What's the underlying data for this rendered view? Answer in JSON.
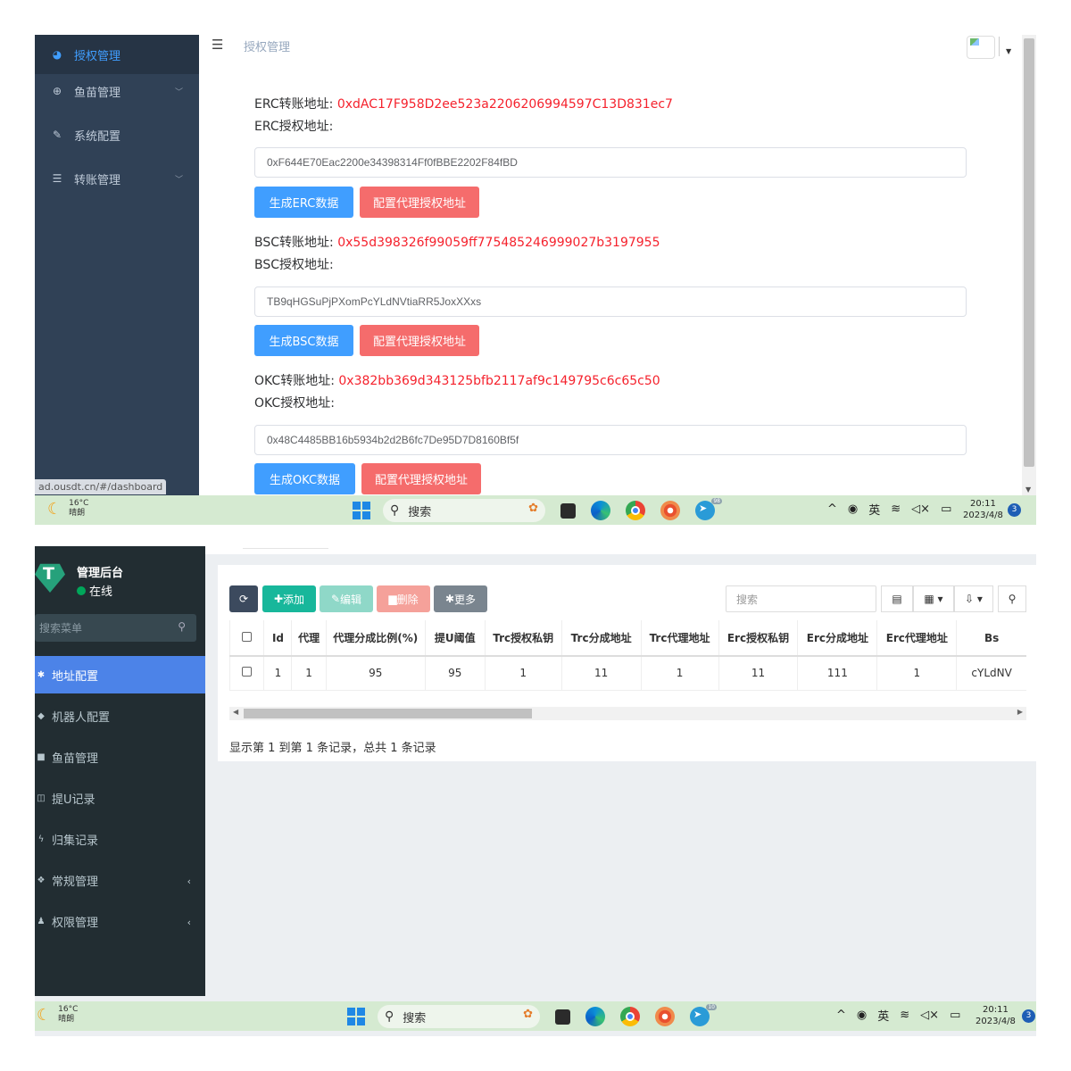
{
  "top": {
    "sidebar": {
      "items": [
        {
          "label": "授权管理",
          "icon": "dashboard-icon"
        },
        {
          "label": "鱼苗管理",
          "icon": "circle-plus-icon"
        },
        {
          "label": "系统配置",
          "icon": "document-edit-icon"
        },
        {
          "label": "转账管理",
          "icon": "list-icon"
        }
      ]
    },
    "status_url": "ad.ousdt.cn/#/dashboard",
    "breadcrumb": "授权管理",
    "erc": {
      "transfer_label": "ERC转账地址:",
      "transfer_address": "0xdAC17F958D2ee523a2206206994597C13D831ec7",
      "auth_label": "ERC授权地址:",
      "auth_value": "0xF644E70Eac2200e34398314Ff0fBBE2202F84fBD",
      "gen_button": "生成ERC数据",
      "config_button": "配置代理授权地址"
    },
    "bsc": {
      "transfer_label": "BSC转账地址:",
      "transfer_address": "0x55d398326f99059ff775485246999027b3197955",
      "auth_label": "BSC授权地址:",
      "auth_value": "TB9qHGSuPjPXomPcYLdNVtiaRR5JoxXXxs",
      "gen_button": "生成BSC数据",
      "config_button": "配置代理授权地址"
    },
    "okc": {
      "transfer_label": "OKC转账地址:",
      "transfer_address": "0x382bb369d343125bfb2117af9c149795c6c65c50",
      "auth_label": "OKC授权地址:",
      "auth_value": "0x48C4485BB16b5934b2d2B6fc7De95D7D8160Bf5f",
      "gen_button": "生成OKC数据",
      "config_button": "配置代理授权地址"
    },
    "taskbar": {
      "temp": "16°C",
      "weather": "晴朗",
      "search": "搜索",
      "badge": "98",
      "lang": "英",
      "time": "20:11",
      "date": "2023/4/8",
      "notifications": "3"
    }
  },
  "bottom": {
    "brand": "管理后台",
    "status": "在线",
    "search_placeholder": "搜索菜单",
    "menu": [
      {
        "label": "地址配置",
        "icon": "gear-icon"
      },
      {
        "label": "机器人配置",
        "icon": "robot-icon"
      },
      {
        "label": "鱼苗管理",
        "icon": "lock-icon"
      },
      {
        "label": "提U记录",
        "icon": "bookmark-icon"
      },
      {
        "label": "归集记录",
        "icon": "bolt-icon"
      },
      {
        "label": "常规管理",
        "icon": "cogs-icon"
      },
      {
        "label": "权限管理",
        "icon": "users-icon"
      }
    ],
    "toolbar": {
      "add": "添加",
      "edit": "编辑",
      "delete": "删除",
      "more": "更多",
      "search_placeholder": "搜索"
    },
    "table": {
      "headers": [
        "Id",
        "代理",
        "代理分成比例(%)",
        "提U阈值",
        "Trc授权私钥",
        "Trc分成地址",
        "Trc代理地址",
        "Erc授权私钥",
        "Erc分成地址",
        "Erc代理地址",
        "Bs"
      ],
      "row": [
        "1",
        "1",
        "95",
        "95",
        "1",
        "11",
        "1",
        "11",
        "111",
        "1",
        "cYLdNV"
      ]
    },
    "pager": "显示第 1 到第 1 条记录，总共 1 条记录",
    "taskbar": {
      "temp": "16°C",
      "weather": "晴朗",
      "search": "搜索",
      "badge": "10",
      "lang": "英",
      "time": "20:11",
      "date": "2023/4/8",
      "notifications": "3"
    }
  }
}
